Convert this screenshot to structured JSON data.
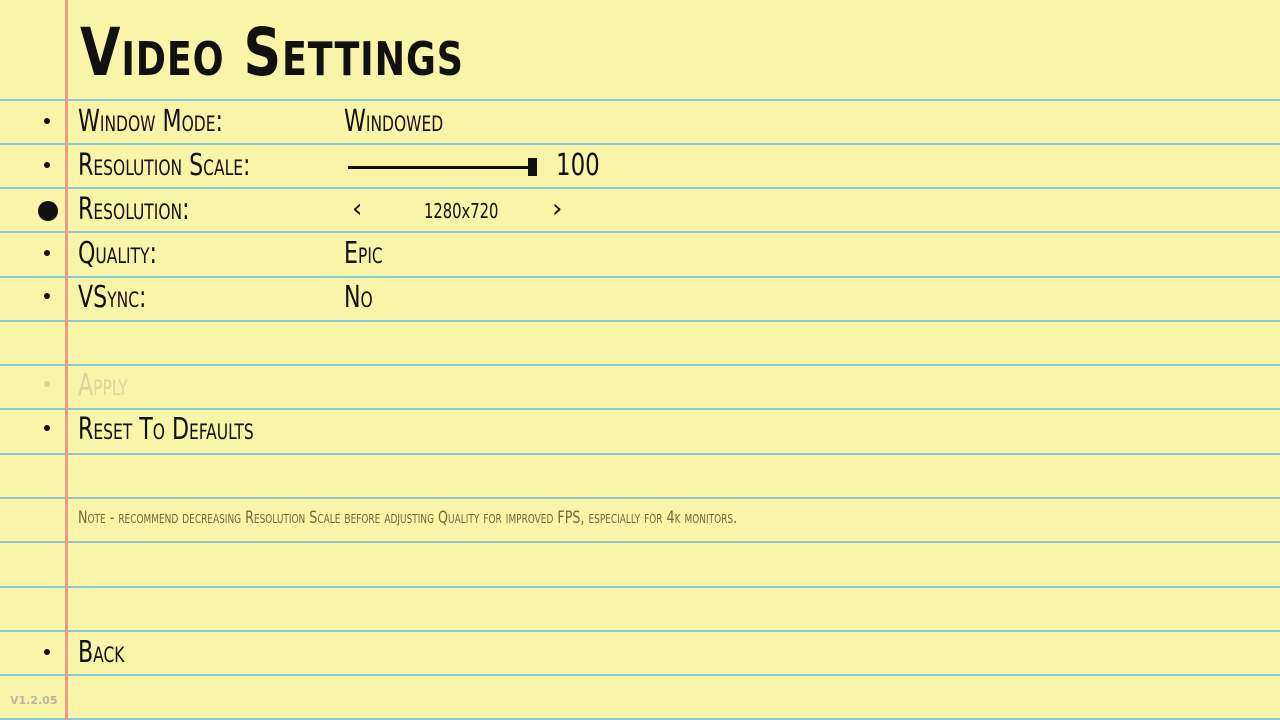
{
  "title": "Video Settings",
  "settings": {
    "window_mode": {
      "label": "Window Mode:",
      "value": "Windowed"
    },
    "resolution_scale": {
      "label": "Resolution Scale:",
      "value": "100",
      "fraction": 1.0
    },
    "resolution": {
      "label": "Resolution:",
      "value": "1280x720",
      "prev": "‹",
      "next": "›"
    },
    "quality": {
      "label": "Quality:",
      "value": "Epic"
    },
    "vsync": {
      "label": "VSync:",
      "value": "No"
    }
  },
  "actions": {
    "apply": "Apply",
    "reset": "Reset To Defaults",
    "back": "Back"
  },
  "note": "Note - recommend decreasing Resolution Scale before adjusting Quality for improved FPS, especially for 4k monitors.",
  "version": "V1.2.05",
  "colors": {
    "paper": "#f8f5a8",
    "rule_line": "#8cc9d6",
    "margin_line": "#ef9a86",
    "ink": "#111111",
    "disabled": "#d8d5a2"
  },
  "selected_row": "resolution"
}
